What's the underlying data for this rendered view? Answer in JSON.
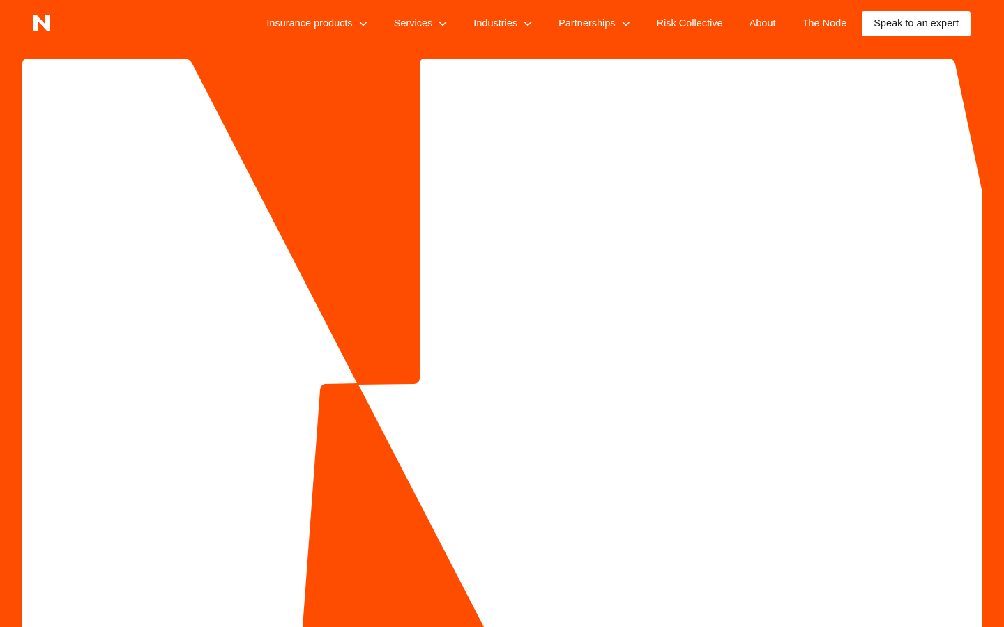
{
  "brand": {
    "accent": "#FF4D00",
    "logo_icon": "n-logo-icon"
  },
  "nav": {
    "items": [
      {
        "label": "Insurance products",
        "has_dropdown": true
      },
      {
        "label": "Services",
        "has_dropdown": true
      },
      {
        "label": "Industries",
        "has_dropdown": true
      },
      {
        "label": "Partnerships",
        "has_dropdown": true
      },
      {
        "label": "Risk Collective",
        "has_dropdown": false
      },
      {
        "label": "About",
        "has_dropdown": false
      },
      {
        "label": "The Node",
        "has_dropdown": false
      }
    ],
    "cta_label": "Speak to an expert"
  },
  "icons": {
    "dropdown": "chevron-down-icon"
  }
}
